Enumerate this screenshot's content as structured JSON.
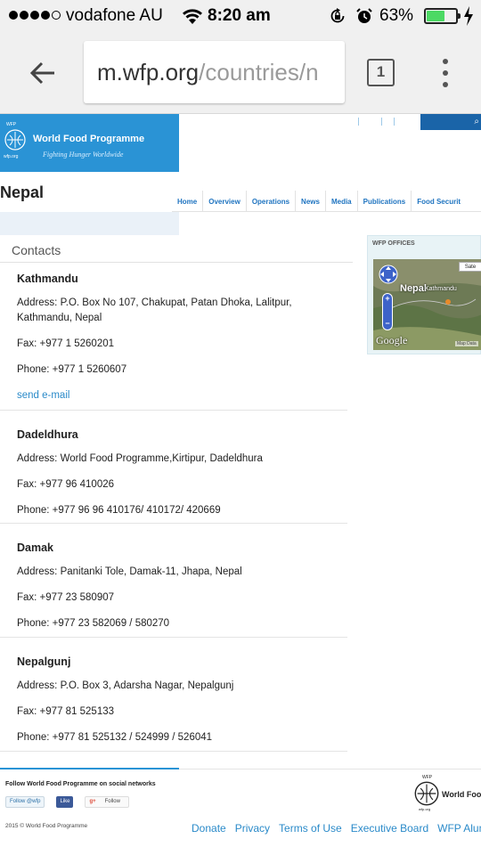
{
  "status_bar": {
    "carrier": "vodafone AU",
    "time": "8:20 am",
    "battery_percent": "63%",
    "battery_level": 0.63,
    "signal_bars_filled": 4,
    "signal_bars_total": 5
  },
  "browser": {
    "url_host": "m.wfp.org",
    "url_path": "/countries/n",
    "tab_count": "1"
  },
  "header": {
    "logo_small_top": "WFP",
    "logo_small_bottom": "wfp.org",
    "logo_name": "World Food Programme",
    "logo_tagline": "Fighting Hunger Worldwide"
  },
  "page_title": "Nepal",
  "nav": [
    "Home",
    "Overview",
    "Operations",
    "News",
    "Media",
    "Publications",
    "Food Securit"
  ],
  "contacts": {
    "heading": "Contacts",
    "offices": [
      {
        "name": "Kathmandu",
        "address": "Address: P.O. Box No 107, Chakupat, Patan Dhoka, Lalitpur, Kathmandu, Nepal",
        "fax": "Fax: +977 1 5260201",
        "phone": "Phone: +977 1 5260607",
        "email": "send e-mail"
      },
      {
        "name": "Dadeldhura",
        "address": "Address: World Food Programme,Kirtipur, Dadeldhura",
        "fax": "Fax: +977 96 410026",
        "phone": "Phone: +977 96 96 410176/ 410172/ 420669"
      },
      {
        "name": "Damak",
        "address": "Address: Panitanki Tole, Damak-11, Jhapa, Nepal",
        "fax": "Fax: +977 23 580907",
        "phone": "Phone: +977 23 582069 / 580270"
      },
      {
        "name": "Nepalgunj",
        "address": "Address: P.O. Box 3, Adarsha Nagar, Nepalgunj",
        "fax": "Fax: +977 81 525133",
        "phone": "Phone: +977 81 525132 / 524999 / 526041"
      }
    ]
  },
  "sidebar": {
    "title": "WFP OFFICES",
    "map": {
      "label_country": "Nepal",
      "label_city": "Kathmandu",
      "label_town": "aihpur",
      "provider": "Google",
      "sat_button": "Sate",
      "data_note": "Map Data"
    }
  },
  "footer": {
    "social_title": "Follow World Food Programme on social networks",
    "twitter_label": "Follow @wfp",
    "facebook_label": "Like",
    "gplus_g": "g+",
    "gplus_label": "Follow",
    "copyright": "2015 © World Food Programme",
    "logo_top": "WFP",
    "logo_name": "World Food",
    "logo_bottom": "wfp.org",
    "links": [
      "Donate",
      "Privacy",
      "Terms of Use",
      "Executive Board",
      "WFP Alum"
    ]
  },
  "colors": {
    "brand_blue": "#2a93d5",
    "link_blue": "#2a8ac9",
    "battery_green": "#4cd964"
  }
}
